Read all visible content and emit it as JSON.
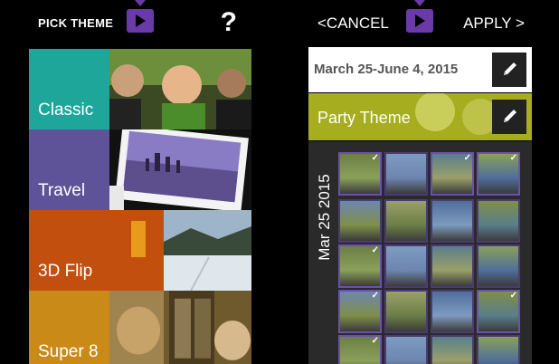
{
  "left_screen": {
    "title": "PICK THEME",
    "help": "?",
    "themes": [
      {
        "label": "Classic"
      },
      {
        "label": "Travel"
      },
      {
        "label": "3D Flip"
      },
      {
        "label": "Super 8"
      }
    ]
  },
  "right_screen": {
    "cancel": "<CANCEL",
    "apply": "APPLY >",
    "date_range": "March 25-June 4, 2015",
    "theme_name": "Party Theme",
    "gallery_date": "Mar 25 2015",
    "thumbnail_count": 20
  },
  "colors": {
    "classic": "#1fa69b",
    "travel": "#5e5398",
    "flip3d": "#c24f0e",
    "super8": "#c98a18",
    "party": "#a6ad1f",
    "accent": "#6b50b0"
  },
  "icons": [
    "video-logo-icon",
    "help-icon",
    "edit-pencil-icon",
    "checkmark-icon"
  ]
}
